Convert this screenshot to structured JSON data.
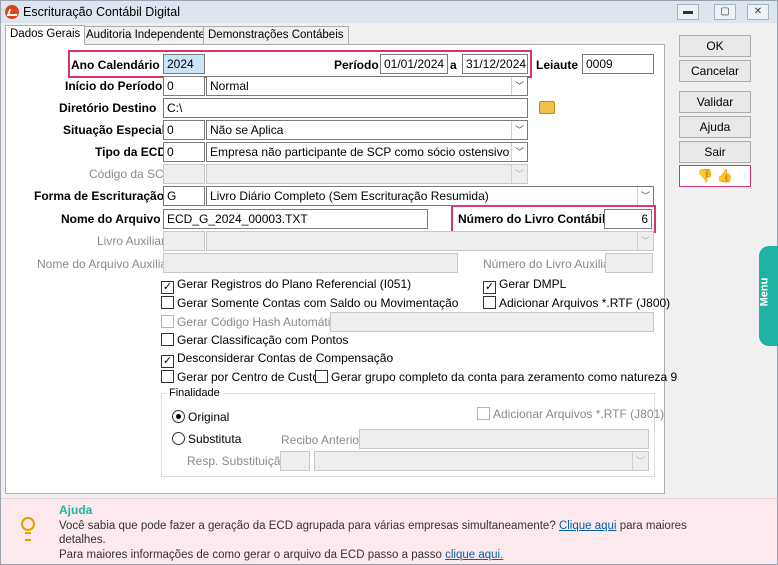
{
  "window": {
    "title": "Escrituração Contábil Digital",
    "min_icon": "minimize-icon",
    "max_icon": "maximize-icon",
    "close_icon": "close-icon"
  },
  "tabs": [
    {
      "label": "Dados Gerais"
    },
    {
      "label": "Auditoria Independente"
    },
    {
      "label": "Demonstrações Contábeis"
    }
  ],
  "form": {
    "ano_label": "Ano Calendário",
    "ano_value": "2024",
    "periodo_label": "Período",
    "periodo_inicio": "01/01/2024",
    "periodo_sep": "a",
    "periodo_fim": "31/12/2024",
    "leiaute_label": "Leiaute",
    "leiaute_value": "0009",
    "inicio_label": "Início do Período",
    "inicio_code": "0",
    "inicio_desc": "Normal",
    "diretorio_label": "Diretório Destino",
    "diretorio_value": "C:\\",
    "situacao_label": "Situação Especial",
    "situacao_code": "0",
    "situacao_desc": "Não se Aplica",
    "tipo_label": "Tipo da ECD",
    "tipo_code": "0",
    "tipo_desc": "Empresa não participante de SCP como sócio ostensivo",
    "scp_label": "Código da SCP",
    "forma_label": "Forma de Escrituração",
    "forma_code": "G",
    "forma_desc": "Livro Diário Completo (Sem Escrituração Resumida)",
    "arquivo_label": "Nome do Arquivo",
    "arquivo_value": "ECD_G_2024_00003.TXT",
    "numero_livro_label": "Número do Livro Contábil",
    "numero_livro_value": "6",
    "livro_aux_label": "Livro Auxiliar",
    "arquivo_aux_label": "Nome do Arquivo Auxiliar",
    "numero_livro_aux_label": "Número do Livro Auxiliar"
  },
  "checks": {
    "referencial": "Gerar Registros do Plano Referencial (I051)",
    "dmpl": "Gerar DMPL",
    "somente_contas": "Gerar Somente Contas com Saldo ou Movimentação",
    "rtf_j800": "Adicionar Arquivos *.RTF (J800)",
    "hash": "Gerar Código Hash Automático",
    "pontos": "Gerar Classificação com Pontos",
    "compensacao": "Desconsiderar Contas de Compensação",
    "centro_custo": "Gerar por Centro de Custo",
    "grupo_completo": "Gerar grupo completo da conta para zeramento como natureza 9"
  },
  "finalidade": {
    "title": "Finalidade",
    "original": "Original",
    "substituta": "Substituta",
    "rtf_j801": "Adicionar Arquivos *.RTF (J801)",
    "recibo_label": "Recibo Anterior",
    "resp_label": "Resp. Substituição"
  },
  "buttons": {
    "ok": "OK",
    "cancelar": "Cancelar",
    "validar": "Validar",
    "ajuda": "Ajuda",
    "sair": "Sair"
  },
  "side_tab": "Menu",
  "help": {
    "title": "Ajuda",
    "line1_text": "Você sabia que pode fazer a geração da ECD agrupada para várias empresas simultaneamente?",
    "line1_link": "Clique aqui",
    "line1_tail": "para maiores",
    "line2": "detalhes.",
    "line3_text": "Para maiores informações de como gerar o arquivo da ECD passo a passo",
    "line3_link": "clique aqui."
  },
  "colors": {
    "highlight": "#d8336a",
    "accent": "#1fb3a3",
    "help_bg": "#fbe9ee"
  }
}
